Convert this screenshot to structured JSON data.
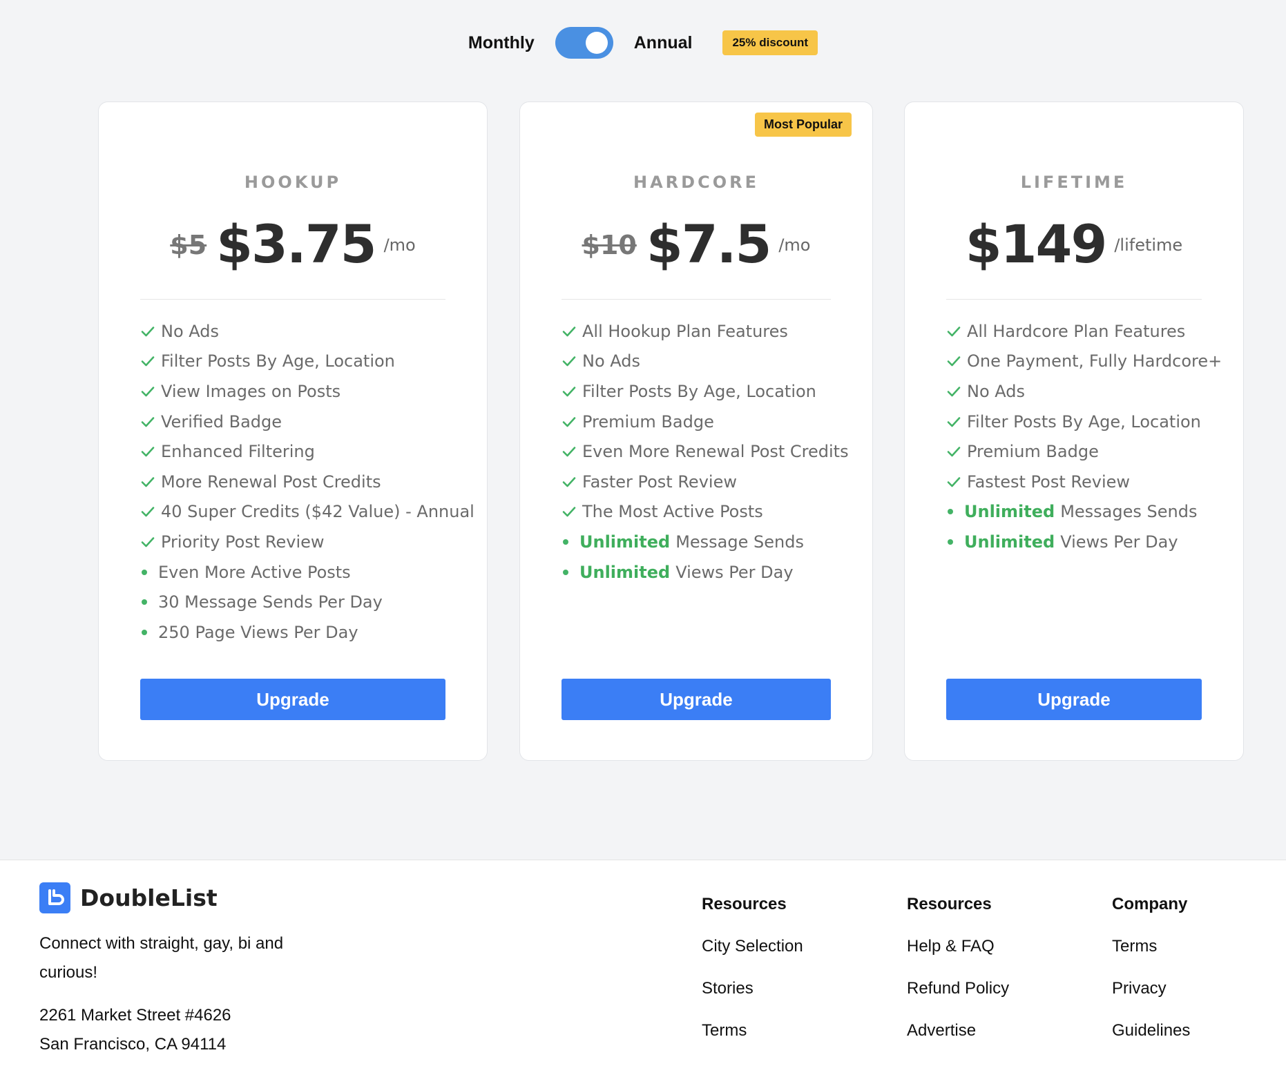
{
  "billing_toggle": {
    "monthly_label": "Monthly",
    "annual_label": "Annual",
    "selected": "Annual",
    "discount_badge": "25% discount"
  },
  "plans": [
    {
      "name": "HOOKUP",
      "old_price": "$5",
      "price": "$3.75",
      "period": "/mo",
      "features": [
        {
          "type": "check",
          "text": "No Ads"
        },
        {
          "type": "check",
          "text": "Filter Posts By Age, Location"
        },
        {
          "type": "check",
          "text": "View Images on Posts"
        },
        {
          "type": "check",
          "text": "Verified Badge"
        },
        {
          "type": "check",
          "text": "Enhanced Filtering"
        },
        {
          "type": "check",
          "text": "More Renewal Post Credits"
        },
        {
          "type": "check",
          "text": "40 Super Credits ($42 Value) - Annual"
        },
        {
          "type": "check",
          "text": "Priority Post Review"
        },
        {
          "type": "dot",
          "text": "Even More Active Posts"
        },
        {
          "type": "dot",
          "text": "30 Message Sends Per Day"
        },
        {
          "type": "dot",
          "text": "250 Page Views Per Day"
        }
      ],
      "button": "Upgrade"
    },
    {
      "name": "HARDCORE",
      "badge": "Most Popular",
      "old_price": "$10",
      "price": "$7.5",
      "period": "/mo",
      "features": [
        {
          "type": "check",
          "text": "All Hookup Plan Features"
        },
        {
          "type": "check",
          "text": "No Ads"
        },
        {
          "type": "check",
          "text": "Filter Posts By Age, Location"
        },
        {
          "type": "check",
          "text": "Premium Badge"
        },
        {
          "type": "check",
          "text": "Even More Renewal Post Credits"
        },
        {
          "type": "check",
          "text": "Faster Post Review"
        },
        {
          "type": "check",
          "text": "The Most Active Posts"
        },
        {
          "type": "dot",
          "highlight": "Unlimited",
          "text": "Message Sends"
        },
        {
          "type": "dot",
          "highlight": "Unlimited",
          "text": "Views Per Day"
        }
      ],
      "button": "Upgrade"
    },
    {
      "name": "LIFETIME",
      "price": "$149",
      "period": "/lifetime",
      "features": [
        {
          "type": "check",
          "text": "All Hardcore Plan Features"
        },
        {
          "type": "check",
          "text": "One Payment, Fully Hardcore+"
        },
        {
          "type": "check",
          "text": "No Ads"
        },
        {
          "type": "check",
          "text": "Filter Posts By Age, Location"
        },
        {
          "type": "check",
          "text": "Premium Badge"
        },
        {
          "type": "check",
          "text": "Fastest Post Review"
        },
        {
          "type": "dot",
          "highlight": "Unlimited",
          "text": "Messages Sends"
        },
        {
          "type": "dot",
          "highlight": "Unlimited",
          "text": "Views Per Day"
        }
      ],
      "button": "Upgrade"
    }
  ],
  "footer": {
    "brand": "DoubleList",
    "tagline": "Connect with straight, gay, bi and curious!",
    "address_line1": "2261 Market Street #4626",
    "address_line2": "San Francisco, CA 94114",
    "columns": [
      {
        "title": "Resources",
        "links": [
          "City Selection",
          "Stories",
          "Terms"
        ]
      },
      {
        "title": "Resources",
        "links": [
          "Help & FAQ",
          "Refund Policy",
          "Advertise"
        ]
      },
      {
        "title": "Company",
        "links": [
          "Terms",
          "Privacy",
          "Guidelines"
        ]
      }
    ]
  },
  "colors": {
    "accent": "#3b7ef5",
    "toggle": "#4a90e2",
    "badge": "#f7c548",
    "feature_green": "#43b366",
    "background": "#f3f4f6"
  },
  "icons": {
    "check": "check-icon",
    "bullet": "dot-icon",
    "logo": "doublelist-logo-icon"
  }
}
